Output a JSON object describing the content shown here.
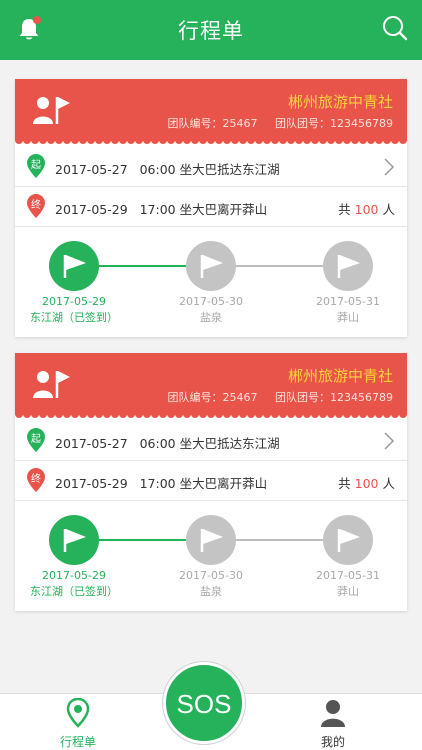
{
  "header": {
    "title": "行程单",
    "left_icon": "bell-icon",
    "right_icon": "search-icon",
    "bell_badge_color": "#e9544a"
  },
  "colors": {
    "primary": "#25b25a",
    "card_header": "#e9544a",
    "agency_text": "#ffd23c",
    "inactive_step": "#c4c4c4"
  },
  "itineraries": [
    {
      "agency": "郴州旅游中青社",
      "team_no_label": "团队编号：25467",
      "group_no_label": "团队团号：123456789",
      "start": {
        "badge": "起",
        "date": "2017-05-27",
        "time": "06:00",
        "desc": "坐大巴抵达东江湖"
      },
      "end": {
        "badge": "终",
        "date": "2017-05-29",
        "time": "17:00",
        "desc": "坐大巴离开莽山"
      },
      "count_prefix": "共",
      "count": "100",
      "count_suffix": "人",
      "steps": [
        {
          "date": "2017-05-29",
          "place": "东江湖（已签到）",
          "active": true
        },
        {
          "date": "2017-05-30",
          "place": "盐泉",
          "active": false
        },
        {
          "date": "2017-05-31",
          "place": "莽山",
          "active": false
        }
      ]
    },
    {
      "agency": "郴州旅游中青社",
      "team_no_label": "团队编号：25467",
      "group_no_label": "团队团号：123456789",
      "start": {
        "badge": "起",
        "date": "2017-05-27",
        "time": "06:00",
        "desc": "坐大巴抵达东江湖"
      },
      "end": {
        "badge": "终",
        "date": "2017-05-29",
        "time": "17:00",
        "desc": "坐大巴离开莽山"
      },
      "count_prefix": "共",
      "count": "100",
      "count_suffix": "人",
      "steps": [
        {
          "date": "2017-05-29",
          "place": "东江湖（已签到）",
          "active": true
        },
        {
          "date": "2017-05-30",
          "place": "盐泉",
          "active": false
        },
        {
          "date": "2017-05-31",
          "place": "莽山",
          "active": false
        }
      ]
    }
  ],
  "tabbar": {
    "left_label": "行程单",
    "sos_label": "SOS",
    "right_label": "我的"
  }
}
